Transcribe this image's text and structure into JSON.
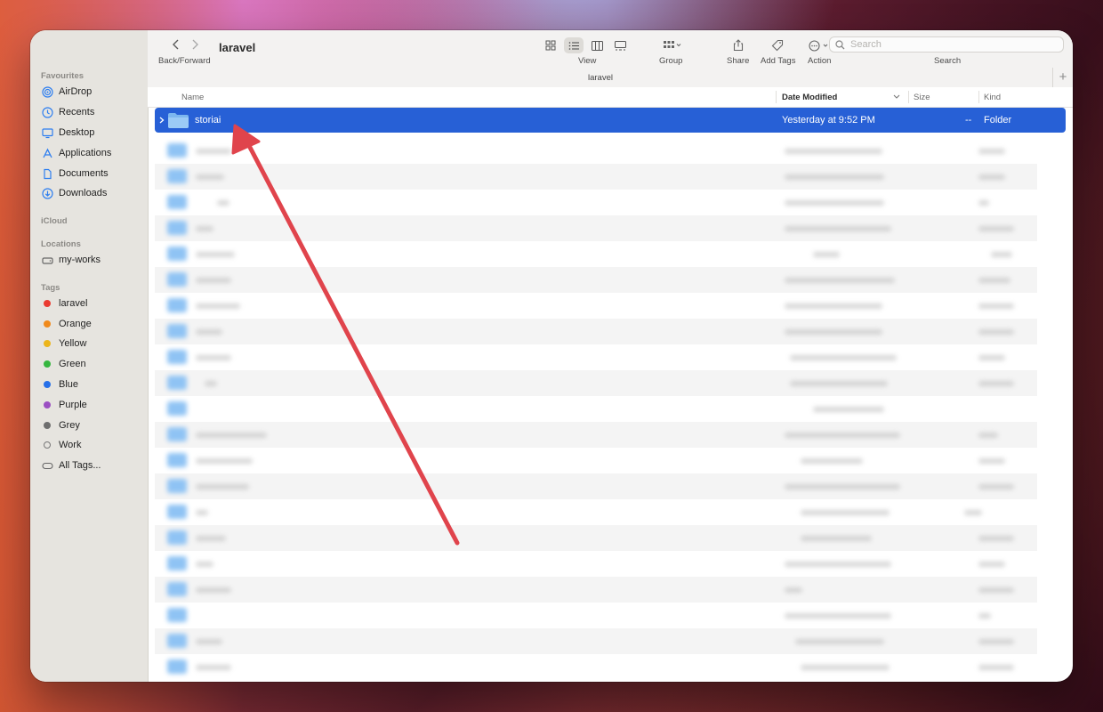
{
  "window": {
    "title": "laravel",
    "path": "laravel"
  },
  "toolbar": {
    "back_forward_label": "Back/Forward",
    "view_label": "View",
    "group_label": "Group",
    "share_label": "Share",
    "add_tags_label": "Add Tags",
    "action_label": "Action",
    "search_placeholder": "Search",
    "search_label": "Search"
  },
  "sidebar": {
    "favourites_header": "Favourites",
    "favourites": [
      {
        "label": "AirDrop",
        "icon": "airdrop-icon"
      },
      {
        "label": "Recents",
        "icon": "clock-icon"
      },
      {
        "label": "Desktop",
        "icon": "desktop-icon"
      },
      {
        "label": "Applications",
        "icon": "applications-icon"
      },
      {
        "label": "Documents",
        "icon": "document-icon"
      },
      {
        "label": "Downloads",
        "icon": "download-icon"
      }
    ],
    "icloud_header": "iCloud",
    "locations_header": "Locations",
    "locations": [
      {
        "label": "my-works",
        "icon": "drive-icon"
      }
    ],
    "tags_header": "Tags",
    "tags": [
      {
        "label": "laravel",
        "color": "#ea3b31"
      },
      {
        "label": "Orange",
        "color": "#f08a1c"
      },
      {
        "label": "Yellow",
        "color": "#ecb51b"
      },
      {
        "label": "Green",
        "color": "#36b63f"
      },
      {
        "label": "Blue",
        "color": "#2670e8"
      },
      {
        "label": "Purple",
        "color": "#9b4fc2"
      },
      {
        "label": "Grey",
        "color": "#6e6e6e"
      },
      {
        "label": "Work",
        "color": "hollow"
      },
      {
        "label": "All Tags...",
        "color": "all"
      }
    ]
  },
  "columns": {
    "name": "Name",
    "date_modified": "Date Modified",
    "size": "Size",
    "kind": "Kind"
  },
  "selected_row": {
    "name": "storiai",
    "date_modified": "Yesterday at 9:52 PM",
    "size": "--",
    "kind": "Folder"
  },
  "colors": {
    "selection": "#2760d6",
    "annotation_arrow": "#e0444c"
  }
}
